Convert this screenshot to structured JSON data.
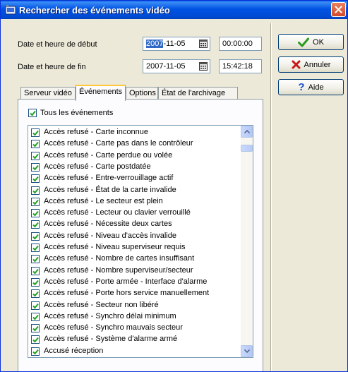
{
  "window": {
    "title": "Rechercher des événements vidéo"
  },
  "start": {
    "label": "Date et heure de début",
    "date_selected": "2007",
    "date_rest": "-11-05",
    "time": "00:00:00"
  },
  "end": {
    "label": "Date et heure de fin",
    "date": "2007-11-05",
    "time": "15:42:18"
  },
  "buttons": {
    "ok": "OK",
    "cancel": "Annuler",
    "help": "Aide"
  },
  "tabs": [
    {
      "label": "Serveur vidéo"
    },
    {
      "label": "Événements"
    },
    {
      "label": "Options"
    },
    {
      "label": "État de l'archivage"
    }
  ],
  "all_events": {
    "label": "Tous les événements",
    "checked": true
  },
  "events": [
    "Accès refusé - Carte inconnue",
    "Accès refusé - Carte pas dans le contrôleur",
    "Accès refusé - Carte perdue ou volée",
    "Accès refusé - Carte postdatée",
    "Accès refusé - Entre-verrouillage actif",
    "Accès refusé - État de la carte invalide",
    "Accès refusé - Le secteur est plein",
    "Accès refusé - Lecteur ou clavier verrouillé",
    "Accès refusé - Nécessite deux cartes",
    "Accès refusé - Niveau d'accès invalide",
    "Accès refusé - Niveau superviseur requis",
    "Accès refusé - Nombre de cartes insuffisant",
    "Accès refusé - Nombre superviseur/secteur",
    "Accès refusé - Porte armée - Interface d'alarme",
    "Accès refusé - Porte hors service manuellement",
    "Accès refusé - Secteur non libéré",
    "Accès refusé - Synchro délai minimum",
    "Accès refusé - Synchro mauvais secteur",
    "Accès refusé - Système d'alarme armé",
    "Accusé réception"
  ],
  "colors": {
    "title_blue": "#0054e3",
    "close_red": "#d04a2a",
    "ok_green": "#2a9a1e",
    "cancel_red": "#c81818",
    "help_blue": "#1a4fd0",
    "tab_highlight": "#ffc83c"
  }
}
